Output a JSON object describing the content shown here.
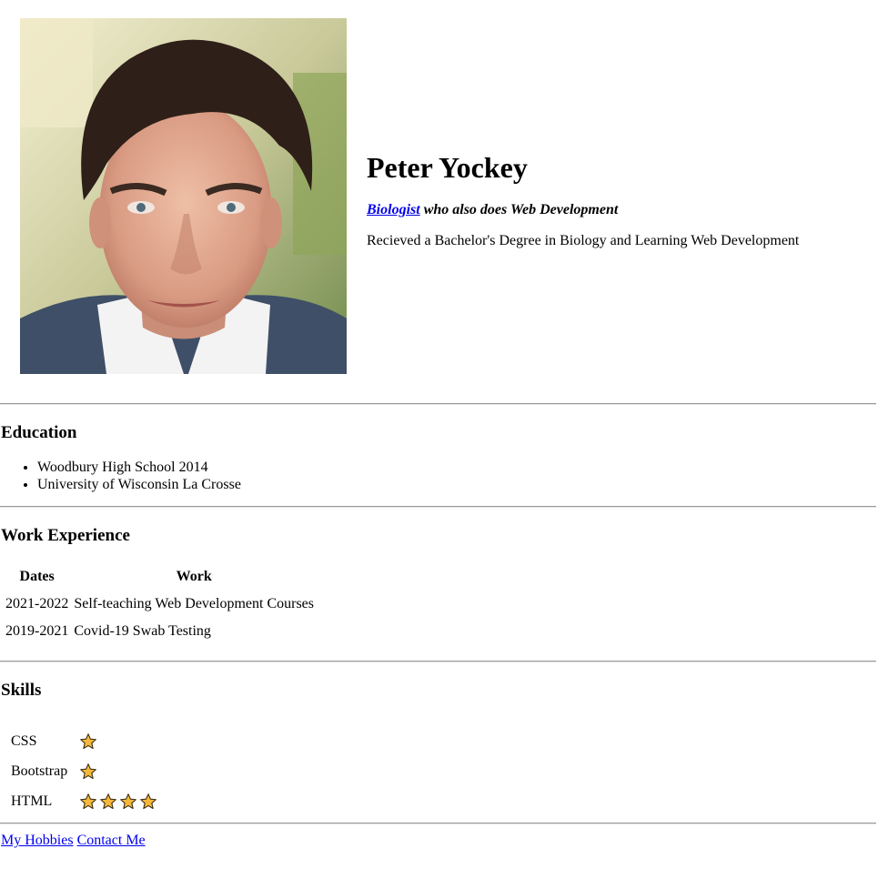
{
  "profile": {
    "name": "Peter Yockey",
    "tagline_link": "Biologist",
    "tagline_rest": " who also does Web Development",
    "summary": "Recieved a Bachelor's Degree in Biology and Learning Web Development",
    "photo_alt": "profile photo"
  },
  "education": {
    "heading": "Education",
    "items": [
      "Woodbury High School 2014",
      "University of Wisconsin La Crosse"
    ]
  },
  "work": {
    "heading": "Work Experience",
    "columns": [
      "Dates",
      "Work"
    ],
    "rows": [
      [
        "2021-2022",
        "Self-teaching Web Development Courses"
      ],
      [
        "2019-2021",
        "Covid-19 Swab Testing"
      ]
    ]
  },
  "skills": {
    "heading": "Skills",
    "items": [
      {
        "name": "CSS",
        "stars": 1
      },
      {
        "name": "Bootstrap",
        "stars": 1
      },
      {
        "name": "HTML",
        "stars": 4
      }
    ],
    "star_icon": "star-icon",
    "star_color": "#f6b83c"
  },
  "footer": {
    "links": [
      "My Hobbies",
      "Contact Me"
    ]
  }
}
